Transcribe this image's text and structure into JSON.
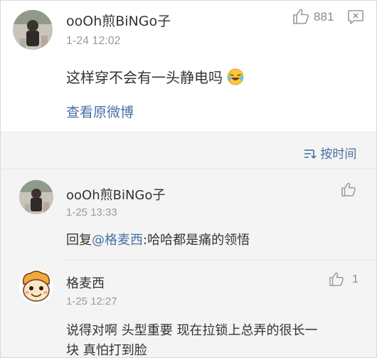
{
  "post": {
    "username": "ooOh煎BiNGo子",
    "time": "1-24 12:02",
    "like_count": "881",
    "text": "这样穿不会有一头静电吗",
    "emoji_name": "laugh-cry-icon",
    "view_original": "查看原微博"
  },
  "sort": {
    "label": "按时间",
    "icon": "sort-icon"
  },
  "comments": [
    {
      "username": "ooOh煎BiNGo子",
      "time": "1-25 13:33",
      "reply_prefix": "回复",
      "mention": "@格麦西",
      "text": ":哈哈都是痛的领悟",
      "like_count": ""
    },
    {
      "username": "格麦西",
      "time": "1-25 12:27",
      "like_count": "1",
      "text_line1": "说得对啊 头型重要  现在拉锁上总弄的很长一",
      "text_line2": "块 真怕打到脸"
    }
  ],
  "colors": {
    "link": "#4a6fa5",
    "secondary_text": "#9b9b9b",
    "background_gray": "#f4f4f4"
  }
}
